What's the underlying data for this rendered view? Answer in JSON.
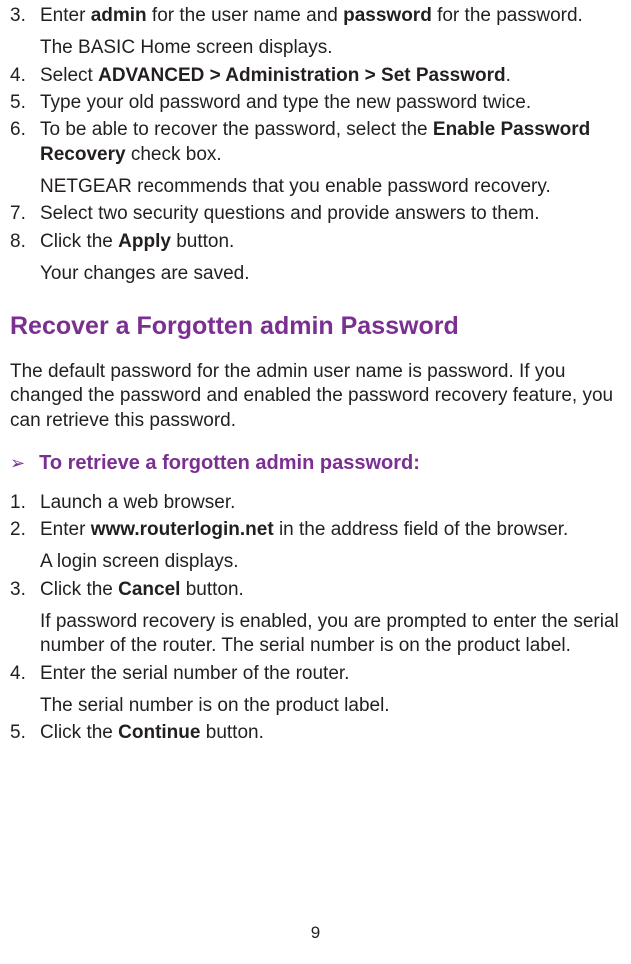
{
  "list1": {
    "items": [
      {
        "num": "3.",
        "parts": [
          "Enter ",
          "admin",
          " for the user name and ",
          "password",
          " for the password."
        ],
        "bold": [
          1,
          3
        ],
        "sub": "The BASIC Home screen displays."
      },
      {
        "num": "4.",
        "parts": [
          "Select ",
          "ADVANCED > Administration > Set Password",
          "."
        ],
        "bold": [
          1
        ]
      },
      {
        "num": "5.",
        "parts": [
          "Type your old password and type the new password twice."
        ],
        "bold": []
      },
      {
        "num": "6.",
        "parts": [
          "To be able to recover the password, select the ",
          "Enable Password Recovery",
          " check box."
        ],
        "bold": [
          1
        ],
        "sub": "NETGEAR recommends that you enable password recovery."
      },
      {
        "num": "7.",
        "parts": [
          "Select two security questions and provide answers to them."
        ],
        "bold": []
      },
      {
        "num": "8.",
        "parts": [
          "Click the ",
          "Apply",
          " button."
        ],
        "bold": [
          1
        ],
        "sub": "Your changes are saved."
      }
    ]
  },
  "heading": "Recover a Forgotten admin Password",
  "intro": "The default password for the admin user name is password. If you changed the password and enabled the password recovery feature, you can retrieve this password.",
  "proc_arrow": "➢",
  "proc_title": "To retrieve a forgotten admin password:",
  "list2": {
    "items": [
      {
        "num": "1.",
        "parts": [
          "Launch a web browser."
        ],
        "bold": []
      },
      {
        "num": "2.",
        "parts": [
          "Enter ",
          "www.routerlogin.net",
          " in the address field of the browser."
        ],
        "bold": [
          1
        ],
        "sub": "A login screen displays."
      },
      {
        "num": "3.",
        "parts": [
          "Click the ",
          "Cancel",
          " button."
        ],
        "bold": [
          1
        ],
        "sub": "If password recovery is enabled, you are prompted to enter the serial number of the router. The serial number is on the product label."
      },
      {
        "num": "4.",
        "parts": [
          "Enter the serial number of the router."
        ],
        "bold": [],
        "sub": "The serial number is on the product label."
      },
      {
        "num": "5.",
        "parts": [
          "Click the ",
          "Continue",
          " button."
        ],
        "bold": [
          1
        ]
      }
    ]
  },
  "page_number": "9"
}
